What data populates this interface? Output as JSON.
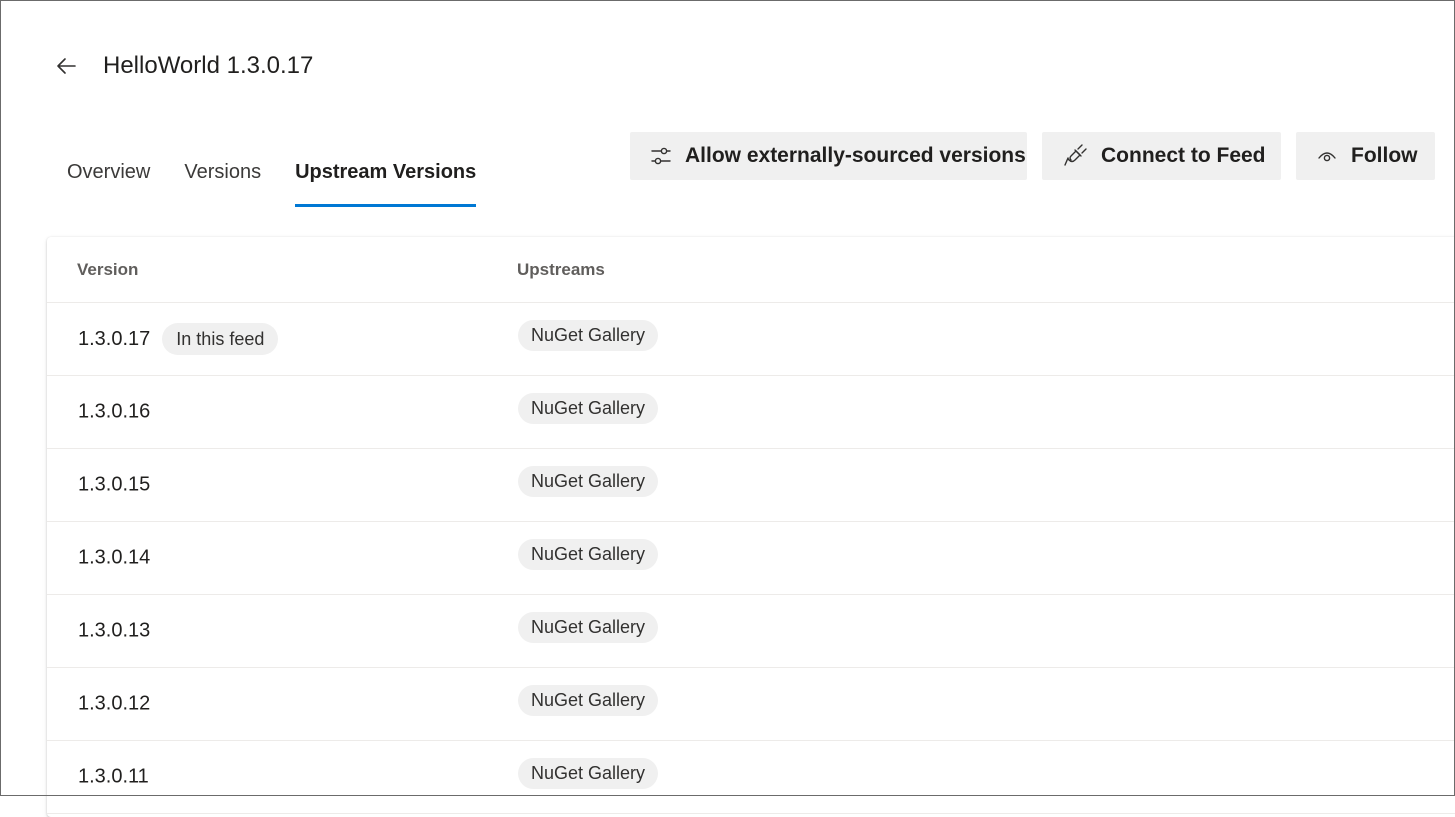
{
  "header": {
    "title": "HelloWorld 1.3.0.17",
    "back_icon": "arrow-left-icon"
  },
  "tabs": [
    {
      "label": "Overview",
      "active": false
    },
    {
      "label": "Versions",
      "active": false
    },
    {
      "label": "Upstream Versions",
      "active": true
    }
  ],
  "actions": {
    "allow_label": "Allow externally-sourced versions",
    "allow_icon": "sliders-icon",
    "connect_label": "Connect to Feed",
    "connect_icon": "plug-icon",
    "follow_label": "Follow",
    "follow_icon": "eye-icon"
  },
  "colors": {
    "accent": "#0078d4",
    "button_bg": "#f0f0f0",
    "pill_bg": "#f0f0f0"
  },
  "table": {
    "columns": [
      "Version",
      "Upstreams"
    ],
    "rows": [
      {
        "version": "1.3.0.17",
        "badge": "In this feed",
        "upstream": "NuGet Gallery"
      },
      {
        "version": "1.3.0.16",
        "badge": "",
        "upstream": "NuGet Gallery"
      },
      {
        "version": "1.3.0.15",
        "badge": "",
        "upstream": "NuGet Gallery"
      },
      {
        "version": "1.3.0.14",
        "badge": "",
        "upstream": "NuGet Gallery"
      },
      {
        "version": "1.3.0.13",
        "badge": "",
        "upstream": "NuGet Gallery"
      },
      {
        "version": "1.3.0.12",
        "badge": "",
        "upstream": "NuGet Gallery"
      },
      {
        "version": "1.3.0.11",
        "badge": "",
        "upstream": "NuGet Gallery"
      }
    ]
  }
}
